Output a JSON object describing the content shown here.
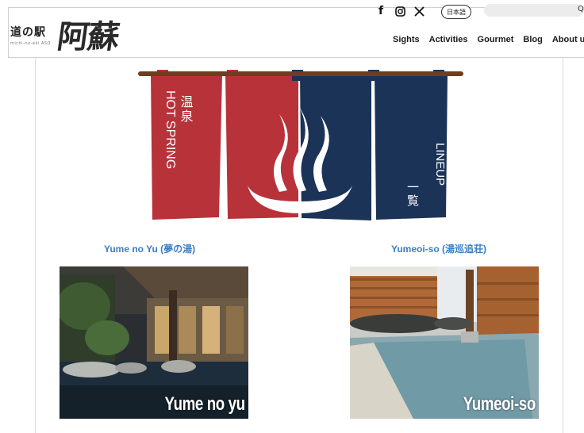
{
  "header": {
    "logo_small": "道の駅",
    "logo_sub": "michi-no-eki ASO",
    "logo_big": "阿蘇",
    "social": [
      {
        "icon": "facebook-icon",
        "glyph": "f"
      },
      {
        "icon": "instagram-icon",
        "glyph": "◎"
      },
      {
        "icon": "x-icon",
        "glyph": "𝕏"
      }
    ],
    "lang_label": "日本語",
    "search_placeholder": "",
    "search_glyph": "Q",
    "nav": [
      {
        "id": "sights",
        "label": "Sights"
      },
      {
        "id": "activities",
        "label": "Activities"
      },
      {
        "id": "gourmet",
        "label": "Gourmet"
      },
      {
        "id": "blog",
        "label": "Blog"
      },
      {
        "id": "about",
        "label": "About u"
      }
    ]
  },
  "banner": {
    "left_jp": "温泉",
    "left_en": "HOT SPRING",
    "right_en": "LINEUP",
    "right_jp": "一覧"
  },
  "cards": [
    {
      "title": "Yume no Yu (夢の湯)",
      "image_label": "Yume no yu"
    },
    {
      "title": "Yumeoi-so (湯巡追荘)",
      "image_label": "Yumeoi-so"
    }
  ],
  "colors": {
    "banner_red": "#b8323a",
    "banner_navy": "#1c3358",
    "link_blue": "#3b7ec4"
  }
}
